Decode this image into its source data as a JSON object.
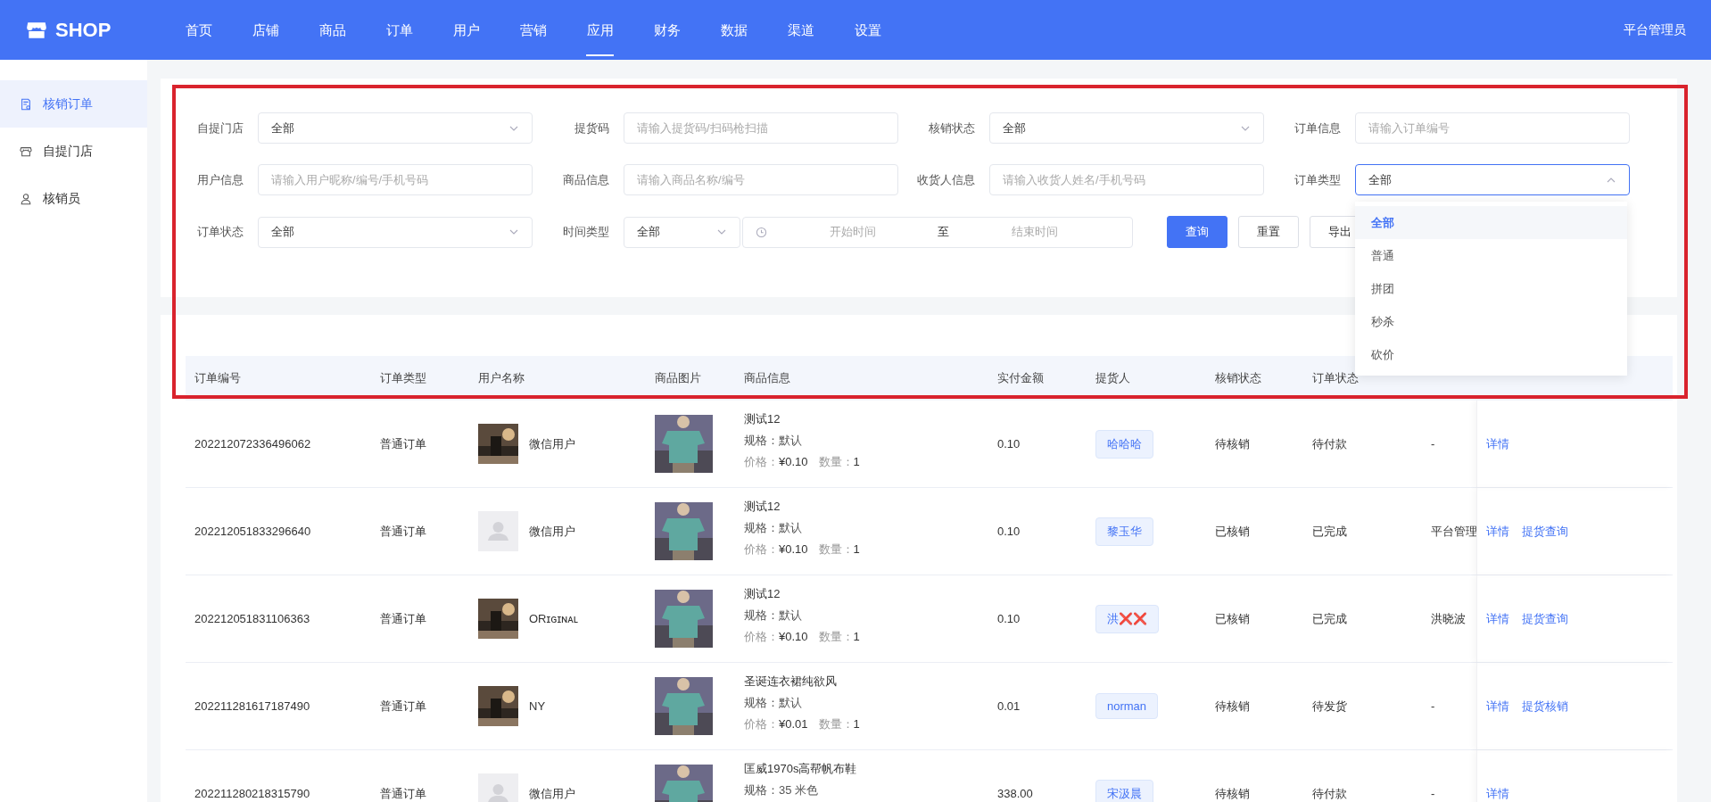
{
  "brand": "SHOP",
  "nav": [
    {
      "label": "首页",
      "selected": false
    },
    {
      "label": "店铺",
      "selected": false
    },
    {
      "label": "商品",
      "selected": false
    },
    {
      "label": "订单",
      "selected": false
    },
    {
      "label": "用户",
      "selected": false
    },
    {
      "label": "营销",
      "selected": false
    },
    {
      "label": "应用",
      "selected": true
    },
    {
      "label": "财务",
      "selected": false
    },
    {
      "label": "数据",
      "selected": false
    },
    {
      "label": "渠道",
      "selected": false
    },
    {
      "label": "设置",
      "selected": false
    }
  ],
  "user": "平台管理员",
  "sidebar": {
    "items": [
      {
        "label": "核销订单",
        "kind": "document",
        "selected": true
      },
      {
        "label": "自提门店",
        "kind": "store",
        "selected": false
      },
      {
        "label": "核销员",
        "kind": "person",
        "selected": false
      }
    ]
  },
  "filters": [
    {
      "label": "自提门店",
      "kind": "select",
      "value": "全部",
      "open": false
    },
    {
      "label": "提货码",
      "kind": "input",
      "placeholder": "请输入提货码/扫码枪扫描"
    },
    {
      "label": "核销状态",
      "kind": "select",
      "value": "全部",
      "open": false
    },
    {
      "label": "订单信息",
      "kind": "input",
      "placeholder": "请输入订单编号"
    },
    {
      "label": "用户信息",
      "kind": "input",
      "placeholder": "请输入用户昵称/编号/手机号码"
    },
    {
      "label": "商品信息",
      "kind": "input",
      "placeholder": "请输入商品名称/编号"
    },
    {
      "label": "收货人信息",
      "kind": "input",
      "placeholder": "请输入收货人姓名/手机号码"
    },
    {
      "label": "订单类型",
      "kind": "select",
      "value": "全部",
      "open": true,
      "options": [
        {
          "label": "全部",
          "selected": true
        },
        {
          "label": "普通",
          "selected": false
        },
        {
          "label": "拼团",
          "selected": false
        },
        {
          "label": "秒杀",
          "selected": false
        },
        {
          "label": "砍价",
          "selected": false
        }
      ]
    },
    {
      "label": "订单状态",
      "kind": "select",
      "value": "全部",
      "open": false
    },
    {
      "label": "时间类型",
      "kind": "range",
      "value": "全部",
      "start_placeholder": "开始时间",
      "separator": "至",
      "end_placeholder": "结束时间"
    }
  ],
  "buttons": [
    {
      "label": "查询",
      "kind": "primary"
    },
    {
      "label": "重置",
      "kind": "default"
    },
    {
      "label": "导出",
      "kind": "default"
    }
  ],
  "table": {
    "columns": [
      "订单编号",
      "订单类型",
      "用户名称",
      "商品图片",
      "商品信息",
      "实付金额",
      "提货人",
      "核销状态",
      "订单状态"
    ],
    "rows": [
      {
        "order_no": "202212072336496062",
        "type": "普通订单",
        "avatar": {
          "kind": "picture"
        },
        "user": "微信用户",
        "title": "测试12",
        "spec": "规格：默认",
        "price_label": "价格：",
        "price": "¥0.10",
        "qty_label": "数量：",
        "qty": "1",
        "amount": "0.10",
        "picker": "哈哈哈",
        "verify_status": "待核销",
        "order_status": "待付款",
        "column_9": "-",
        "actions": [
          "详情"
        ]
      },
      {
        "order_no": "202212051833296640",
        "type": "普通订单",
        "avatar": {
          "kind": "default"
        },
        "user": "微信用户",
        "title": "测试12",
        "spec": "规格：默认",
        "price_label": "价格：",
        "price": "¥0.10",
        "qty_label": "数量：",
        "qty": "1",
        "amount": "0.10",
        "picker": "黎玉华",
        "verify_status": "已核销",
        "order_status": "已完成",
        "column_9": "平台管理",
        "actions": [
          "详情",
          "提货查询"
        ]
      },
      {
        "order_no": "202212051831106363",
        "type": "普通订单",
        "avatar": {
          "kind": "picture"
        },
        "user": "ORɪɢɪɴᴀʟ",
        "title": "测试12",
        "spec": "规格：默认",
        "price_label": "价格：",
        "price": "¥0.10",
        "qty_label": "数量：",
        "qty": "1",
        "amount": "0.10",
        "picker": "洪❌❌",
        "verify_status": "已核销",
        "order_status": "已完成",
        "column_9": "洪晓波",
        "actions": [
          "详情",
          "提货查询"
        ]
      },
      {
        "order_no": "202211281617187490",
        "type": "普通订单",
        "avatar": {
          "kind": "picture"
        },
        "user": "NY",
        "title": "圣诞连衣裙纯欲风",
        "spec": "规格：默认",
        "price_label": "价格：",
        "price": "¥0.01",
        "qty_label": "数量：",
        "qty": "1",
        "amount": "0.01",
        "picker": "norman",
        "verify_status": "待核销",
        "order_status": "待发货",
        "column_9": "-",
        "actions": [
          "详情",
          "提货核销"
        ]
      },
      {
        "order_no": "202211280218315790",
        "type": "普通订单",
        "avatar": {
          "kind": "default"
        },
        "user": "微信用户",
        "title": "匡威1970s高帮帆布鞋",
        "spec": "规格：35 米色",
        "amount": "338.00",
        "picker": "宋汲晨",
        "verify_status": "待核销",
        "order_status": "待付款",
        "column_9": "-",
        "actions": [
          "详情"
        ]
      }
    ]
  }
}
